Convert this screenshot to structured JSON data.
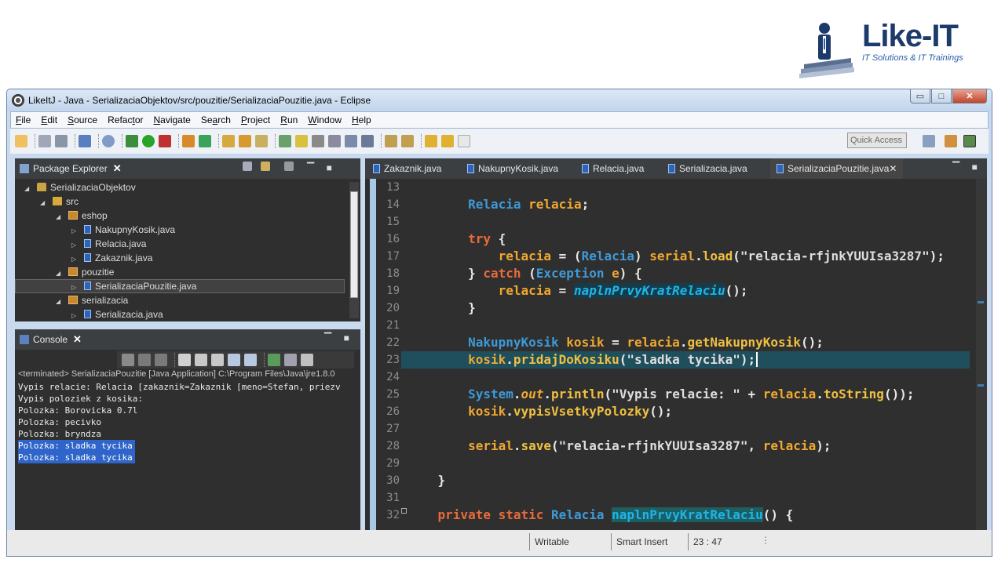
{
  "logo": {
    "name": "Like-IT",
    "tagline": "IT Solutions & IT Trainings"
  },
  "window": {
    "title": "LikeItJ - Java - SerializaciaObjektov/src/pouzitie/SerializaciaPouzitie.java - Eclipse",
    "controls": {
      "minimize": "▭",
      "maximize": "□",
      "close": "✕"
    }
  },
  "menu": [
    {
      "u": "F",
      "rest": "ile"
    },
    {
      "u": "E",
      "rest": "dit"
    },
    {
      "u": "S",
      "rest": "ource"
    },
    {
      "pre": "Refac",
      "u": "t",
      "rest": "or"
    },
    {
      "u": "N",
      "rest": "avigate"
    },
    {
      "pre": "Se",
      "u": "a",
      "rest": "rch"
    },
    {
      "u": "P",
      "rest": "roject"
    },
    {
      "u": "R",
      "rest": "un"
    },
    {
      "u": "W",
      "rest": "indow"
    },
    {
      "u": "H",
      "rest": "elp"
    }
  ],
  "quick_access": "Quick Access",
  "package_explorer": {
    "title": "Package Explorer",
    "tree": [
      {
        "label": "SerializaciaObjektov",
        "level": 0,
        "icon": "project-icon",
        "expanded": true
      },
      {
        "label": "src",
        "level": 1,
        "icon": "source-folder-icon",
        "expanded": true
      },
      {
        "label": "eshop",
        "level": 2,
        "icon": "package-icon",
        "expanded": true
      },
      {
        "label": "NakupnyKosik.java",
        "level": 3,
        "icon": "java-file-icon",
        "expanded": false
      },
      {
        "label": "Relacia.java",
        "level": 3,
        "icon": "java-file-icon",
        "expanded": false
      },
      {
        "label": "Zakaznik.java",
        "level": 3,
        "icon": "java-file-icon",
        "expanded": false
      },
      {
        "label": "pouzitie",
        "level": 2,
        "icon": "package-icon",
        "expanded": true
      },
      {
        "label": "SerializaciaPouzitie.java",
        "level": 3,
        "icon": "java-file-icon",
        "expanded": false,
        "selected": true
      },
      {
        "label": "serializacia",
        "level": 2,
        "icon": "package-icon",
        "expanded": true
      },
      {
        "label": "Serializacia.java",
        "level": 3,
        "icon": "java-file-icon",
        "expanded": false
      }
    ]
  },
  "console": {
    "title": "Console",
    "terminated": "<terminated> SerializaciaPouzitie [Java Application] C:\\Program Files\\Java\\jre1.8.0",
    "lines": [
      {
        "text": "Vypis relacie: Relacia [zakaznik=Zakaznik [meno=Stefan, priezv",
        "hl": false
      },
      {
        "text": "Vypis poloziek z kosika:",
        "hl": false
      },
      {
        "text": "Polozka: Borovicka 0.7l",
        "hl": false
      },
      {
        "text": "Polozka: pecivko",
        "hl": false
      },
      {
        "text": "Polozka: bryndza",
        "hl": false
      },
      {
        "text": "Polozka: sladka tycika",
        "hl": true
      },
      {
        "text": "Polozka: sladka tycika",
        "hl": true
      }
    ]
  },
  "editor": {
    "tabs": [
      {
        "label": "Zakaznik.java",
        "active": false
      },
      {
        "label": "NakupnyKosik.java",
        "active": false
      },
      {
        "label": "Relacia.java",
        "active": false
      },
      {
        "label": "Serializacia.java",
        "active": false
      },
      {
        "label": "SerializaciaPouzitie.java",
        "active": true
      }
    ],
    "line_numbers": [
      "13",
      "14",
      "15",
      "16",
      "17",
      "18",
      "19",
      "20",
      "21",
      "22",
      "23",
      "24",
      "25",
      "26",
      "27",
      "28",
      "29",
      "30",
      "31",
      "32"
    ],
    "code": {
      "l14": {
        "type": "Relacia",
        "var": "relacia",
        "semi": ";"
      },
      "l16": {
        "kw": "try",
        "rest": " {"
      },
      "l17": {
        "var": "relacia",
        "eq": " = (",
        "type": "Relacia",
        "mid": ") ",
        "obj": "serial",
        "dot": ".",
        "meth": "load",
        "open": "(",
        "str": "\"relacia-rfjnkYUUIsa3287\"",
        "close": ");"
      },
      "l18": {
        "pre": "} ",
        "kw": "catch",
        "open": " (",
        "type": "Exception",
        "sp": " ",
        "var": "e",
        "rest": ") {"
      },
      "l19": {
        "var": "relacia",
        "eq": " = ",
        "meth": "naplnPrvyKratRelaciu",
        "rest": "();"
      },
      "l20": {
        "text": "}"
      },
      "l22": {
        "type": "NakupnyKosik",
        "sp": " ",
        "var": "kosik",
        "eq": " = ",
        "obj": "relacia",
        "dot": ".",
        "meth": "getNakupnyKosik",
        "rest": "();"
      },
      "l23": {
        "obj": "kosik",
        "dot": ".",
        "meth": "pridajDoKosiku",
        "open": "(",
        "str": "\"sladka tycika\"",
        "close": ");"
      },
      "l25": {
        "type": "System",
        "dot1": ".",
        "field": "out",
        "dot2": ".",
        "meth": "println",
        "open": "(",
        "str": "\"Vypis relacie: \"",
        "plus": " + ",
        "obj": "relacia",
        "dot3": ".",
        "meth2": "toString",
        "rest": "());"
      },
      "l26": {
        "obj": "kosik",
        "dot": ".",
        "meth": "vypisVsetkyPolozky",
        "rest": "();"
      },
      "l28": {
        "obj": "serial",
        "dot": ".",
        "meth": "save",
        "open": "(",
        "str": "\"relacia-rfjnkYUUIsa3287\"",
        "comma": ", ",
        "var": "relacia",
        "rest": ");"
      },
      "l30": {
        "text": "}"
      },
      "l32": {
        "kw1": "private",
        "kw2": "static",
        "type": "Relacia",
        "meth": "naplnPrvyKratRelaciu",
        "rest": "() {"
      }
    }
  },
  "status": {
    "writable": "Writable",
    "insert": "Smart Insert",
    "position": "23 : 47"
  }
}
